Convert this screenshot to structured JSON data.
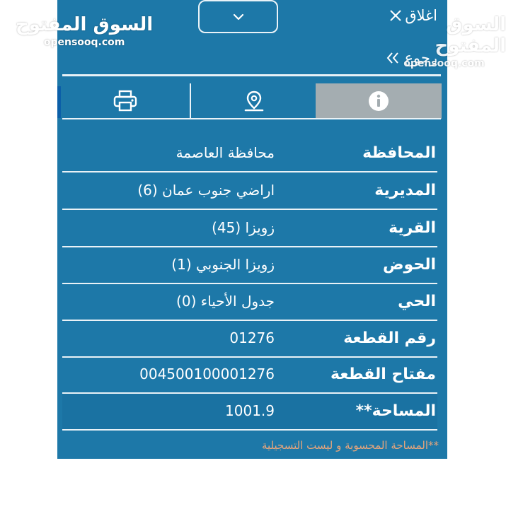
{
  "header": {
    "close_label": "اغلاق",
    "back_label": "رجوع"
  },
  "tabs": [
    {
      "icon": "info-icon"
    },
    {
      "icon": "location-pin-icon"
    },
    {
      "icon": "printer-icon"
    }
  ],
  "details": [
    {
      "label": "المحافظة",
      "value": "محافظة العاصمة"
    },
    {
      "label": "المديرية",
      "value": "اراضي جنوب عمان (6)"
    },
    {
      "label": "القرية",
      "value": "زويزا (45)"
    },
    {
      "label": "الحوض",
      "value": "زويزا الجنوبي (1)"
    },
    {
      "label": "الحي",
      "value": "جدول الأحياء (0)"
    },
    {
      "label": "رقم القطعة",
      "value": "01276"
    },
    {
      "label": "مفتاح القطعة",
      "value": "004500100001276"
    },
    {
      "label": "المساحة**",
      "value": "1001.9"
    }
  ],
  "footnote": "**المساحة المحسوبة و ليست التسجيلية",
  "watermark": {
    "arabic": "السوق المفتوح",
    "latin": "opensooq.com"
  },
  "colors": {
    "panel": "#1d78a8",
    "active_tab": "#a4adb1",
    "footnote": "#e6a57c",
    "accent": "#0b5fa8"
  }
}
